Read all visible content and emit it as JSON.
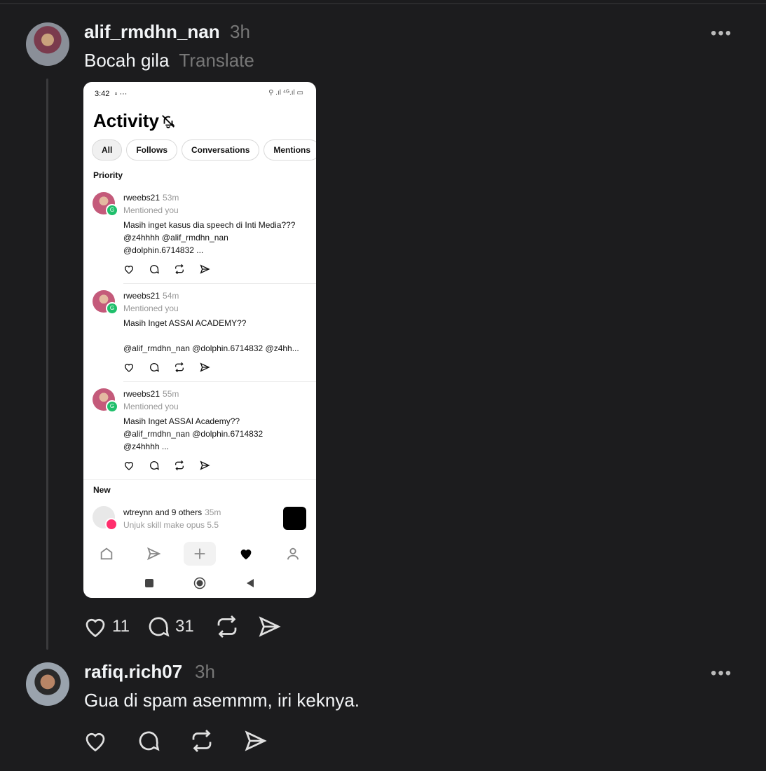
{
  "posts": [
    {
      "username": "alif_rmdhn_nan",
      "time": "3h",
      "text": "Bocah gila",
      "translate": "Translate",
      "likes": "11",
      "replies": "31",
      "more_label": "•••"
    },
    {
      "username": "rafiq.rich07",
      "time": "3h",
      "text": "Gua di spam asemmm, iri keknya.",
      "more_label": "•••"
    }
  ],
  "screenshot": {
    "status_time": "3:42",
    "status_extra": "▫ ···",
    "status_right": "⚲ .ıl ⁴ᴳ.ıl ▭",
    "title": "Activity",
    "chips": [
      "All",
      "Follows",
      "Conversations",
      "Mentions"
    ],
    "section_priority": "Priority",
    "section_new": "New",
    "notifications": [
      {
        "user": "rweebs21",
        "time": "53m",
        "sub": "Mentioned you",
        "text": "Masih inget kasus dia speech di Inti Media???\n@z4hhhh @alif_rmdhn_nan\n@dolphin.6714832 ..."
      },
      {
        "user": "rweebs21",
        "time": "54m",
        "sub": "Mentioned you",
        "text": "Masih Inget ASSAI ACADEMY??\n\n@alif_rmdhn_nan @dolphin.6714832 @z4hh..."
      },
      {
        "user": "rweebs21",
        "time": "55m",
        "sub": "Mentioned you",
        "text": "Masih Inget ASSAI Academy??\n@alif_rmdhn_nan @dolphin.6714832\n@z4hhhh ..."
      }
    ],
    "new_item": {
      "user": "wtreynn and 9 others",
      "time": "35m",
      "sub": "Unjuk skill make opus 5.5"
    },
    "badge_glyph": "G"
  }
}
